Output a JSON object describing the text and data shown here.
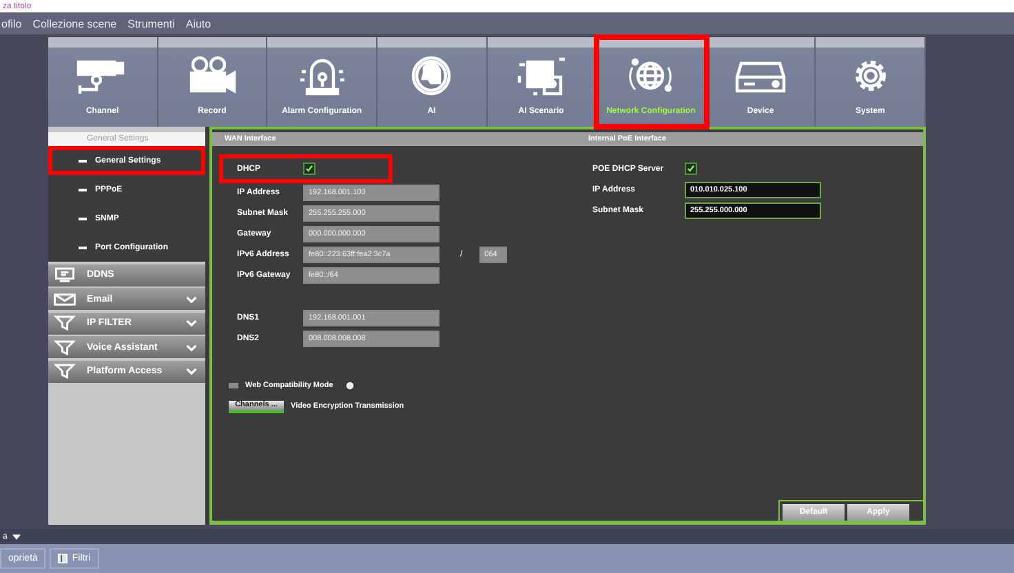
{
  "window": {
    "title": "za titolo"
  },
  "menu": [
    "ofilo",
    "Collezione scene",
    "Strumenti",
    "Aiuto"
  ],
  "tabs": [
    {
      "label": "Channel",
      "selected": false,
      "highlighted": false
    },
    {
      "label": "Record",
      "selected": false,
      "highlighted": false
    },
    {
      "label": "Alarm Configuration",
      "selected": false,
      "highlighted": false
    },
    {
      "label": "AI",
      "selected": false,
      "highlighted": false
    },
    {
      "label": "AI Scenario",
      "selected": false,
      "highlighted": false
    },
    {
      "label": "Network Configuration",
      "selected": true,
      "highlighted": true
    },
    {
      "label": "Device",
      "selected": false,
      "highlighted": false
    },
    {
      "label": "System",
      "selected": false,
      "highlighted": false
    }
  ],
  "sidebar": {
    "header": "General Settings",
    "items": [
      {
        "kind": "sub",
        "label": "General Settings",
        "highlighted": true
      },
      {
        "kind": "sub",
        "label": "PPPoE",
        "highlighted": false
      },
      {
        "kind": "sub",
        "label": "SNMP",
        "highlighted": false
      },
      {
        "kind": "sub",
        "label": "Port Configuration",
        "highlighted": false
      },
      {
        "kind": "group",
        "label": "DDNS",
        "expandable": false
      },
      {
        "kind": "group",
        "label": "Email",
        "expandable": true
      },
      {
        "kind": "group",
        "label": "IP FILTER",
        "expandable": true
      },
      {
        "kind": "group",
        "label": "Voice Assistant",
        "expandable": true
      },
      {
        "kind": "group",
        "label": "Platform Access",
        "expandable": true
      }
    ]
  },
  "wan": {
    "title": "WAN Interface",
    "dhcp": {
      "label": "DHCP",
      "checked": true,
      "highlighted": true
    },
    "fields": [
      {
        "label": "IP Address",
        "value": "192.168.001.100",
        "disabled": true
      },
      {
        "label": "Subnet Mask",
        "value": "255.255.255.000",
        "disabled": true
      },
      {
        "label": "Gateway",
        "value": "000.000.000.000",
        "disabled": true
      },
      {
        "label": "IPv6 Address",
        "value": "fe80::223:63ff:fea2:3c7a",
        "disabled": true,
        "separator": "/",
        "suffix": "064"
      },
      {
        "label": "IPv6 Gateway",
        "value": "fe80::/64",
        "disabled": true
      }
    ],
    "dns_fields": [
      {
        "label": "DNS1",
        "value": "192.168.001.001",
        "disabled": true
      },
      {
        "label": "DNS2",
        "value": "008.008.008.008",
        "disabled": true
      }
    ]
  },
  "poe": {
    "title": "Internal PoE Interface",
    "server": {
      "label": "POE DHCP Server",
      "checked": true
    },
    "fields": [
      {
        "label": "IP Address",
        "value": "010.010.025.100",
        "disabled": false
      },
      {
        "label": "Subnet Mask",
        "value": "255.255.000.000",
        "disabled": false
      }
    ]
  },
  "web_compat": {
    "label": "Web Compatibility Mode",
    "checked": false
  },
  "channels_button": "Channels ...",
  "encryption_label": "Video Encryption Transmission",
  "buttons": [
    "Default",
    "Apply"
  ],
  "bottom": {
    "dropdown": "a",
    "tabs": [
      {
        "label": "oprietà",
        "icon": false
      },
      {
        "label": "Filtri",
        "icon": true
      }
    ]
  }
}
